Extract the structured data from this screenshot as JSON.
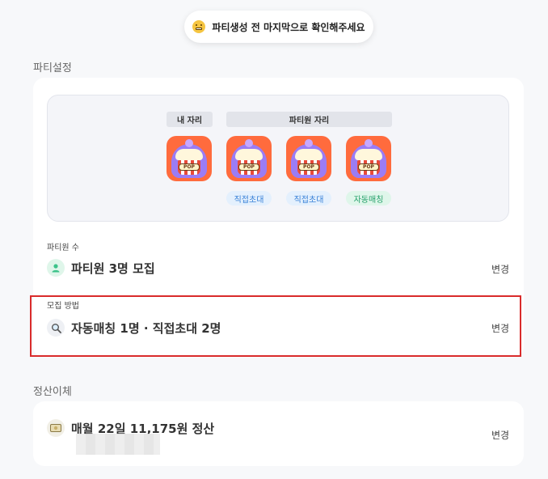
{
  "toast": {
    "text": "파티생성 전 마지막으로 확인해주세요"
  },
  "party_settings": {
    "title": "파티설정",
    "my_seat_label": "내 자리",
    "member_seats_label": "파티원 자리",
    "avatar_text": "POP",
    "tags": [
      "직접초대",
      "직접초대",
      "자동매칭"
    ],
    "member_count": {
      "label": "파티원 수",
      "value": "파티원 3명 모집",
      "change": "변경"
    },
    "recruit_method": {
      "label": "모집 방법",
      "value": "자동매칭 1명 · 직접초대 2명",
      "change": "변경"
    }
  },
  "settlement": {
    "title": "정산이체",
    "value": "매월 22일 11,175원 정산",
    "change": "변경"
  },
  "colors": {
    "avatar_bg": "#ff6b3d",
    "tag_blue": "#3a82d8",
    "tag_green": "#25a06a",
    "highlight": "#d92b2b"
  }
}
